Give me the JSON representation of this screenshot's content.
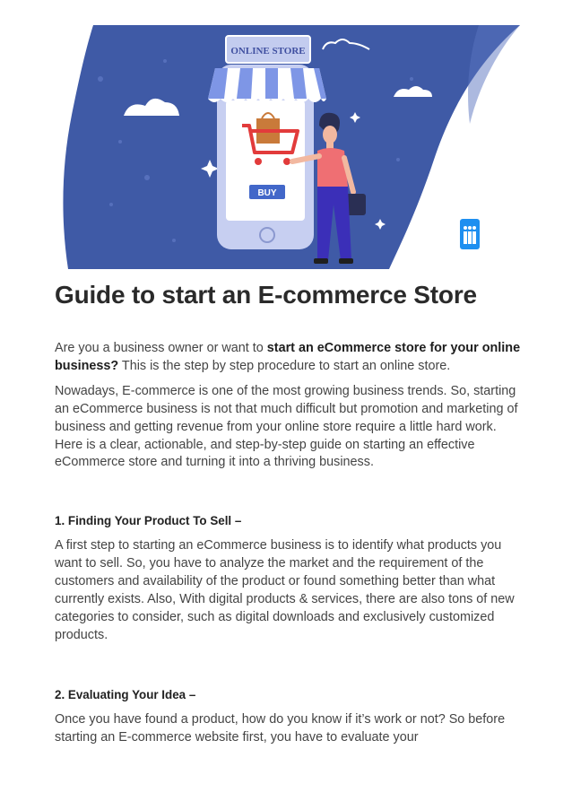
{
  "hero": {
    "sign_text": "ONLINE STORE",
    "buy_label": "BUY",
    "colors": {
      "background": "#3f5aa6",
      "awning_blue": "#7e96e6",
      "awning_white": "#ffffff",
      "phone_body": "#c7cff1",
      "cart": "#e23b3b",
      "bag": "#c97a3a",
      "shirt": "#ef6f73",
      "pants": "#3b2fb8",
      "logo": "#1e8ff0"
    }
  },
  "article": {
    "title": "Guide to start an E-commerce Store",
    "intro": {
      "before": "Are you a business owner or want to ",
      "bold": "start an eCommerce store for your online business?",
      "after": " This is the step by step procedure to start an online store."
    },
    "paragraph2": "Nowadays, E-commerce is one of the most growing business trends. So, starting an eCommerce business is not that much difficult but promotion and marketing of business and getting revenue from your online store require a little hard work. Here is a clear, actionable, and step-by-step guide on starting an effective eCommerce store and turning it into a thriving business.",
    "sections": [
      {
        "heading": "1. Finding Your Product To Sell –",
        "body": "A first step to starting an eCommerce business is to identify what products you want to sell. So, you have to analyze the market and the requirement of the customers and availability of the product or found something better than what currently exists. Also, With digital products & services, there are also tons of new categories to consider, such as digital downloads and exclusively customized products."
      },
      {
        "heading": "2. Evaluating Your Idea –",
        "body": "Once you have found a product, how do you know if it’s work or not? So before starting an E-commerce website first, you have to evaluate your"
      }
    ]
  }
}
